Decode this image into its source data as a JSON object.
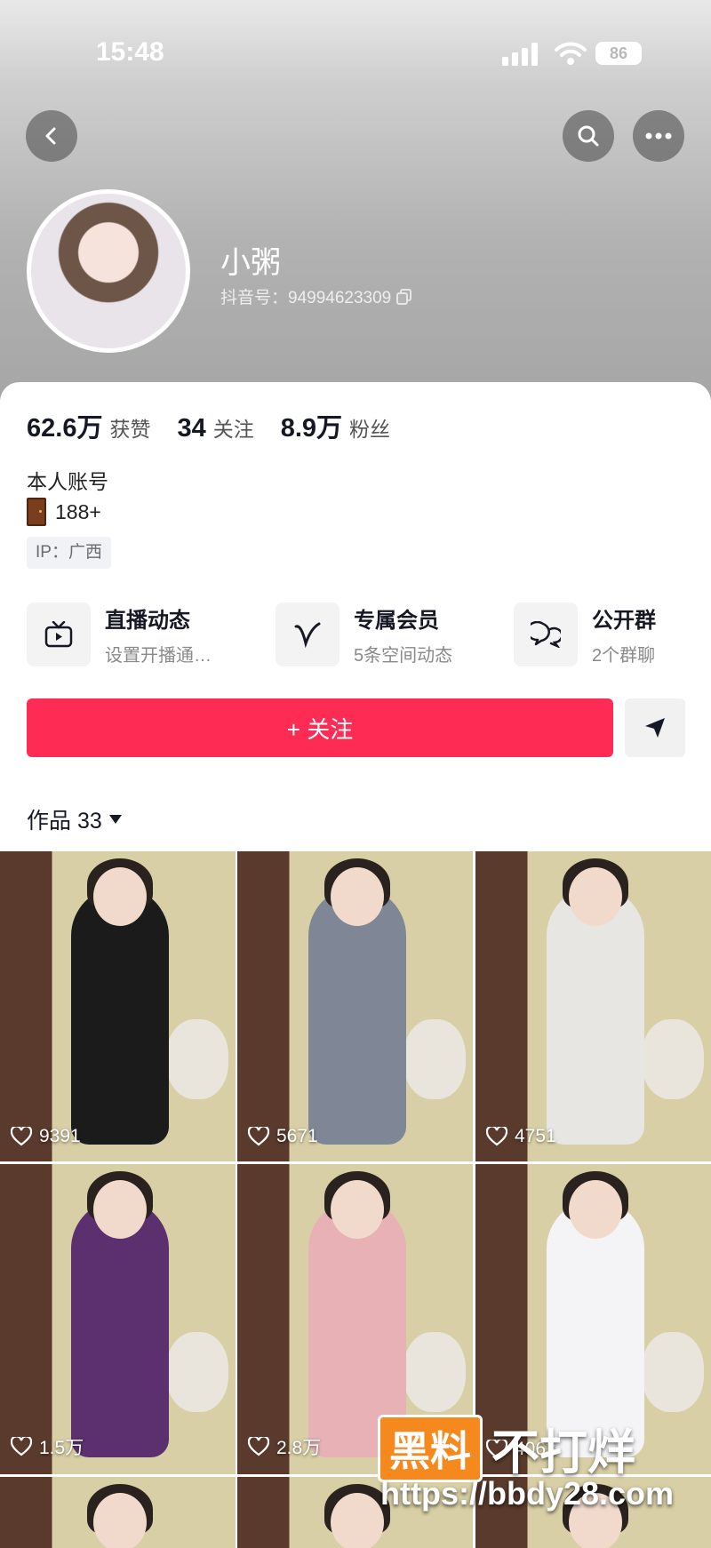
{
  "status_bar": {
    "time": "15:48",
    "battery": "86"
  },
  "profile": {
    "name": "小粥",
    "douyin_id": "抖音号：94994623309",
    "stats": [
      {
        "value": "62.6万",
        "label": "获赞"
      },
      {
        "value": "34",
        "label": "关注"
      },
      {
        "value": "8.9万",
        "label": "粉丝"
      }
    ],
    "bio": "本人账号",
    "level": "188+",
    "ip": "IP：广西"
  },
  "features": [
    {
      "title": "直播动态",
      "subtitle": "设置开播通…",
      "icon": "tv-icon"
    },
    {
      "title": "专属会员",
      "subtitle": "5条空间动态",
      "icon": "v-heart-icon"
    },
    {
      "title": "公开群",
      "subtitle": "2个群聊",
      "icon": "chat-bubbles-icon"
    }
  ],
  "actions": {
    "follow_label": "+ 关注",
    "share_icon": "send-icon"
  },
  "works": {
    "label": "作品 33",
    "items": [
      {
        "likes": "9391",
        "outfit": "#1b1b1b"
      },
      {
        "likes": "5671",
        "outfit": "#7f8796"
      },
      {
        "likes": "4751",
        "outfit": "#e8e6e2"
      },
      {
        "likes": "1.5万",
        "outfit": "#5c2f6e"
      },
      {
        "likes": "2.8万",
        "outfit": "#e7b1b6"
      },
      {
        "likes": "4063",
        "outfit": "#f4f4f6"
      }
    ]
  },
  "watermark": {
    "brand_box": "黑料",
    "brand_text": "不打烊",
    "url": "https://bbdy28.com"
  },
  "colors": {
    "accent": "#fe2c55",
    "watermark": "#f5891e"
  }
}
